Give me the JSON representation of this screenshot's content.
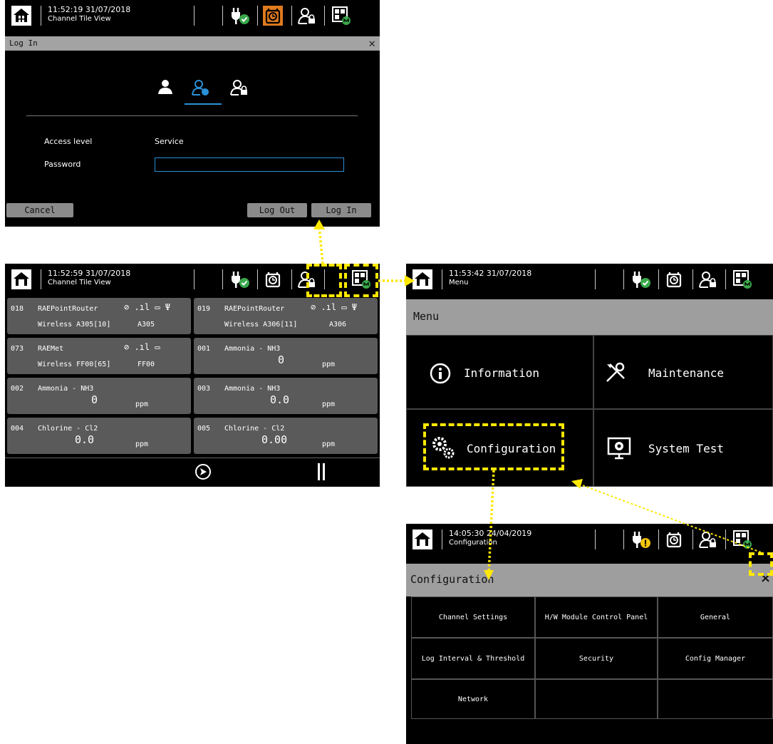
{
  "login_screen": {
    "time": "11:52:19  31/07/2018",
    "view": "Channel Tile View",
    "dialog_title": "Log In",
    "access_level_label": "Access level",
    "access_level_value": "Service",
    "password_label": "Password",
    "password_value": "",
    "cancel_label": "Cancel",
    "logout_label": "Log Out",
    "login_label": "Log In"
  },
  "tile_screen": {
    "time": "11:52:59  31/07/2018",
    "view": "Channel Tile View",
    "tiles": [
      {
        "num": "018",
        "name": "RAEPointRouter",
        "line2": "Wireless A305[10]",
        "code": "A305"
      },
      {
        "num": "019",
        "name": "RAEPointRouter",
        "line2": "Wireless A306[11]",
        "code": "A306"
      },
      {
        "num": "073",
        "name": "RAEMet",
        "line2": "Wireless FF00[65]",
        "code": "FF00"
      },
      {
        "num": "001",
        "name": "Ammonia - NH3",
        "value": "0",
        "unit": "ppm"
      },
      {
        "num": "002",
        "name": "Ammonia - NH3",
        "value": "0",
        "unit": "ppm"
      },
      {
        "num": "003",
        "name": "Ammonia - NH3",
        "value": "0.0",
        "unit": "ppm"
      },
      {
        "num": "004",
        "name": "Chlorine - Cl2",
        "value": "0.0",
        "unit": "ppm"
      },
      {
        "num": "005",
        "name": "Chlorine - Cl2",
        "value": "0.00",
        "unit": "ppm"
      }
    ]
  },
  "menu_screen": {
    "time": "11:53:42  31/07/2018",
    "view": "Menu",
    "title": "Menu",
    "items": [
      "Information",
      "Maintenance",
      "Configuration",
      "System Test"
    ]
  },
  "config_screen": {
    "time": "14:05:30  24/04/2019",
    "view": "Configuration",
    "title": "Configuration",
    "close": "×",
    "items": [
      "Channel Settings",
      "H/W Module Control Panel",
      "General",
      "Log Interval & Threshold",
      "Security",
      "Config Manager",
      "Network",
      "",
      ""
    ]
  },
  "colors": {
    "accent_blue": "#2a8fd6",
    "ok_green": "#3aa84a",
    "alarm_orange": "#e07a1f",
    "warn_yellow": "#f2c40f",
    "highlight": "#ffe800"
  },
  "icons": [
    "home-icon",
    "power-plug-icon",
    "alarm-clock-icon",
    "user-lock-icon",
    "module-grid-icon",
    "info-icon",
    "tools-icon",
    "gears-icon",
    "monitor-gear-icon",
    "next-arrow-icon",
    "pause-icon",
    "close-icon"
  ]
}
